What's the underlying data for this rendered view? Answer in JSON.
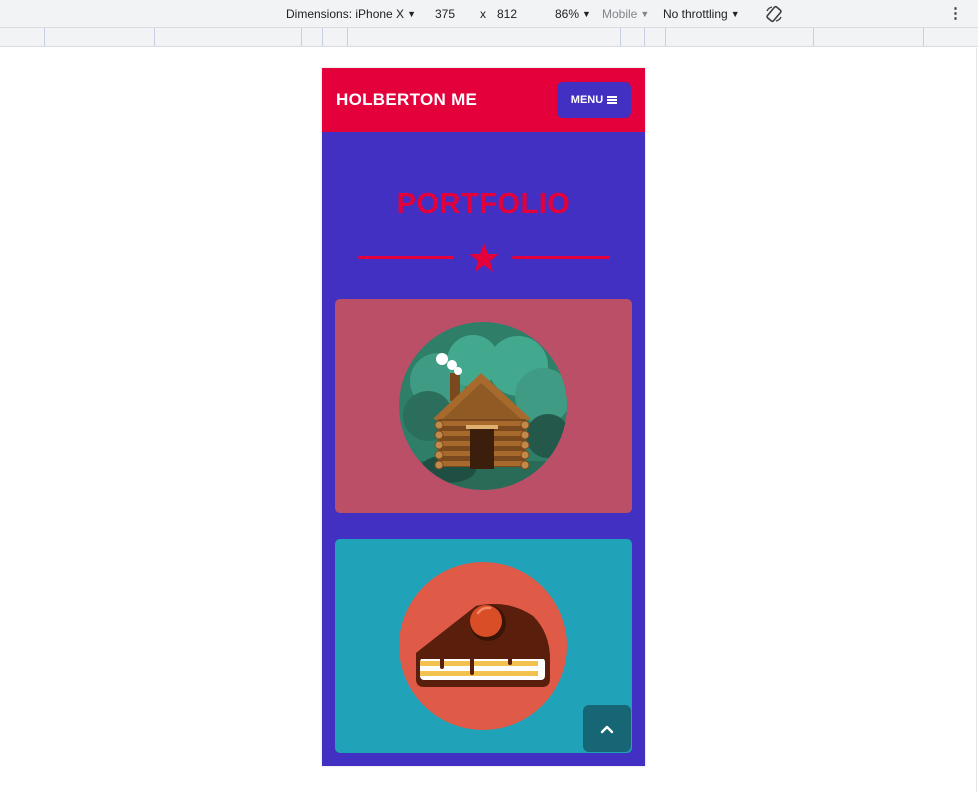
{
  "devtools": {
    "dimensions_label": "Dimensions: iPhone X",
    "width": "375",
    "times": "x",
    "height": "812",
    "zoom": "86%",
    "device_type": "Mobile",
    "throttling": "No throttling"
  },
  "page": {
    "brand": "HOLBERTON ME",
    "menu_label": "MENU",
    "section_title": "PORTFOLIO"
  },
  "portfolio": {
    "items": [
      {
        "icon": "cabin-icon",
        "background": "#bc4f68"
      },
      {
        "icon": "cake-icon",
        "background": "#20a2b8"
      }
    ]
  },
  "colors": {
    "primary": "#e4003b",
    "secondary": "#4230c3",
    "scroll_button": "#176676"
  }
}
